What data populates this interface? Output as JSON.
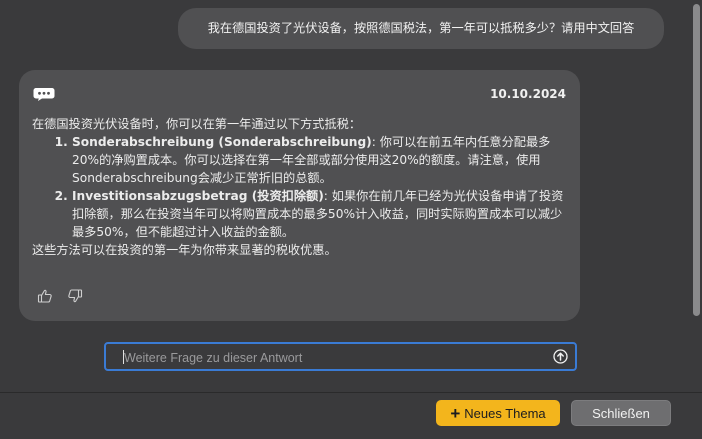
{
  "user_message": "我在德国投资了光伏设备，按照德国税法，第一年可以抵税多少？请用中文回答",
  "answer": {
    "date": "10.10.2024",
    "intro": "在德国投资光伏设备时，你可以在第一年通过以下方式抵税：",
    "items": [
      {
        "term": "Sonderabschreibung (Sonderabschreibung)",
        "text": ": 你可以在前五年内任意分配最多20%的净购置成本。你可以选择在第一年全部或部分使用这20%的额度。请注意，使用Sonderabschreibung会减少正常折旧的总额。"
      },
      {
        "term": "Investitionsabzugsbetrag (投资扣除额)",
        "text": ": 如果你在前几年已经为光伏设备申请了投资扣除额，那么在投资当年可以将购置成本的最多50%计入收益，同时实际购置成本可以减少最多50%，但不能超过计入收益的金额。"
      }
    ],
    "outro": "这些方法可以在投资的第一年为你带来显著的税收优惠。"
  },
  "icons": {
    "chat": "chat-bubble-icon",
    "thumbs_up": "thumbs-up-icon",
    "thumbs_down": "thumbs-down-icon",
    "send": "arrow-up-circle-icon"
  },
  "followup_input": {
    "placeholder": "Weitere Frage zu dieser Antwort",
    "value": ""
  },
  "buttons": {
    "new_topic": "Neues Thema",
    "close": "Schließen"
  },
  "colors": {
    "accent_border": "#3a7bd5",
    "primary_button": "#f3b51c",
    "card_background": "#505052",
    "window_background": "#3a3a3c"
  }
}
